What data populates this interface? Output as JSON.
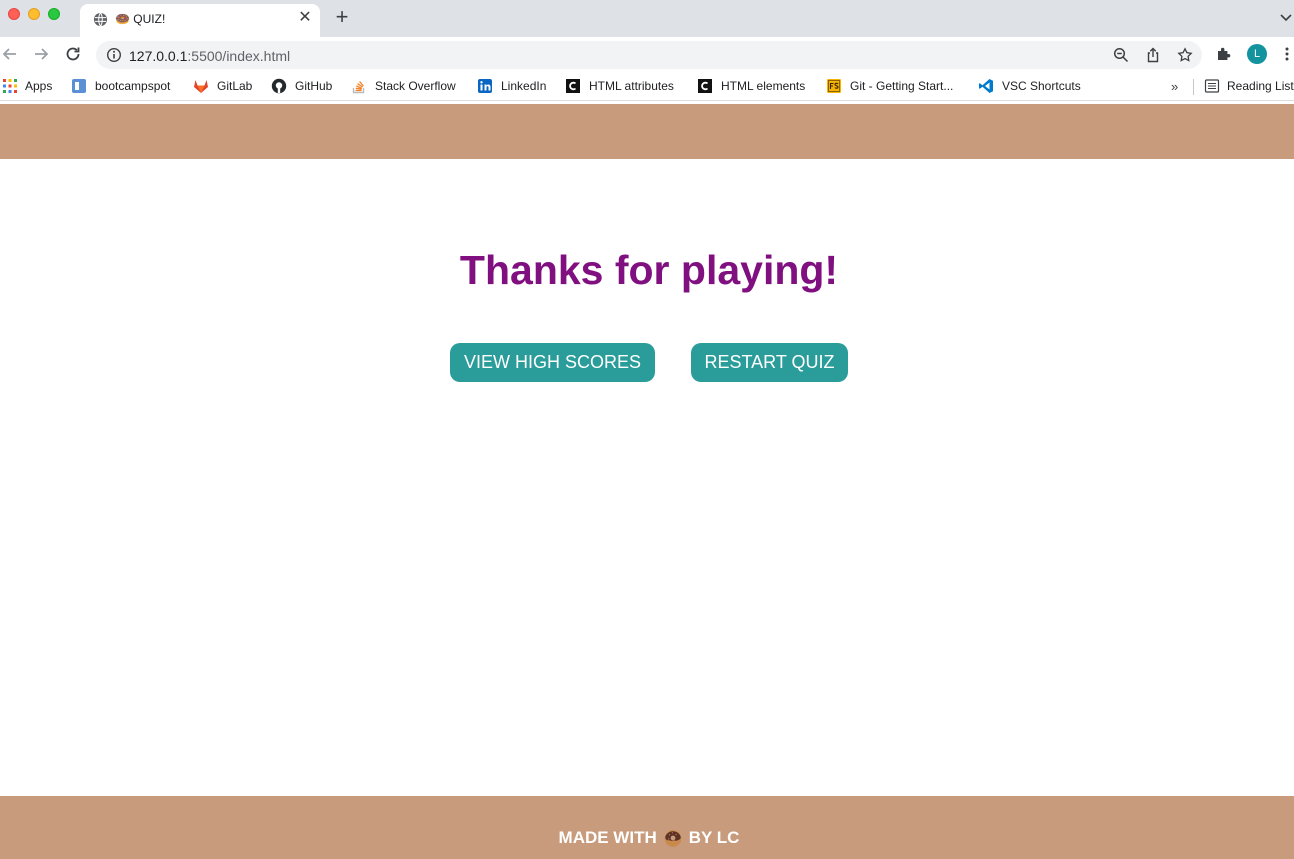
{
  "browser": {
    "tab": {
      "title": "🍩 QUIZ!",
      "favicon": "globe-icon"
    },
    "new_tab_label": "+",
    "url": {
      "host": "127.0.0.1",
      "rest": ":5500/index.html"
    },
    "avatar_letter": "L",
    "bookmarks": [
      {
        "label": "Apps",
        "icon": "apps-grid-icon"
      },
      {
        "label": "bootcampspot",
        "icon": "bootcampspot-icon"
      },
      {
        "label": "GitLab",
        "icon": "gitlab-icon"
      },
      {
        "label": "GitHub",
        "icon": "github-icon"
      },
      {
        "label": "Stack Overflow",
        "icon": "stackoverflow-icon"
      },
      {
        "label": "LinkedIn",
        "icon": "linkedin-icon"
      },
      {
        "label": "HTML attributes",
        "icon": "codecademy-icon"
      },
      {
        "label": "HTML elements",
        "icon": "codecademy-icon"
      },
      {
        "label": "Git - Getting Start...",
        "icon": "fs-icon"
      },
      {
        "label": "VSC Shortcuts",
        "icon": "vscode-icon"
      }
    ],
    "bookmarks_more": "»",
    "reading_list": "Reading List"
  },
  "page": {
    "heading": "Thanks for playing!",
    "buttons": {
      "high_scores": "VIEW HIGH SCORES",
      "restart": "RESTART QUIZ"
    },
    "footer": {
      "before": "MADE WITH",
      "after": "BY LC"
    }
  },
  "colors": {
    "header_footer": "#c79b7c",
    "heading": "#800f80",
    "button": "#2a9c9a"
  }
}
